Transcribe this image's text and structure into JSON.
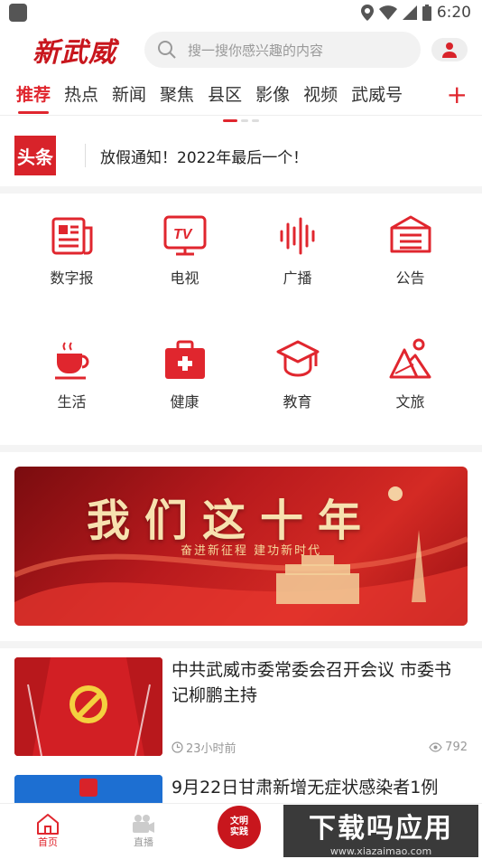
{
  "statusbar": {
    "time": "6:20"
  },
  "header": {
    "logo_text": "新武威",
    "search_placeholder": "搜一搜你感兴趣的内容"
  },
  "tabs": [
    {
      "label": "推荐",
      "active": true
    },
    {
      "label": "热点"
    },
    {
      "label": "新闻"
    },
    {
      "label": "聚焦"
    },
    {
      "label": "县区"
    },
    {
      "label": "影像"
    },
    {
      "label": "视频"
    },
    {
      "label": "武威号"
    }
  ],
  "tab_add_label": "+",
  "headline": {
    "badge": "头条",
    "text": "放假通知！2022年最后一个！"
  },
  "grid": [
    {
      "label": "数字报",
      "icon": "newspaper-icon"
    },
    {
      "label": "电视",
      "icon": "tv-icon"
    },
    {
      "label": "广播",
      "icon": "radio-wave-icon"
    },
    {
      "label": "公告",
      "icon": "notice-icon"
    },
    {
      "label": "生活",
      "icon": "coffee-cup-icon"
    },
    {
      "label": "健康",
      "icon": "first-aid-kit-icon"
    },
    {
      "label": "教育",
      "icon": "graduation-cap-icon"
    },
    {
      "label": "文旅",
      "icon": "mountain-icon"
    }
  ],
  "banner": {
    "title": "我们这十年",
    "subtitle": "奋进新征程 建功新时代"
  },
  "news": [
    {
      "title": "中共武威市委常委会召开会议 市委书记柳鹏主持",
      "time": "23小时前",
      "views": "792"
    },
    {
      "title": "9月22日甘肃新增无症状感染者1例",
      "time": "",
      "views": ""
    }
  ],
  "bottomnav": {
    "home": "首页",
    "live": "直播",
    "center_line1": "文明",
    "center_line2": "实践"
  },
  "watermark": {
    "main": "下载吗应用",
    "url": "www.xiazaimao.com"
  },
  "colors": {
    "brand": "#e0262e",
    "banner": "#b81a1d"
  }
}
